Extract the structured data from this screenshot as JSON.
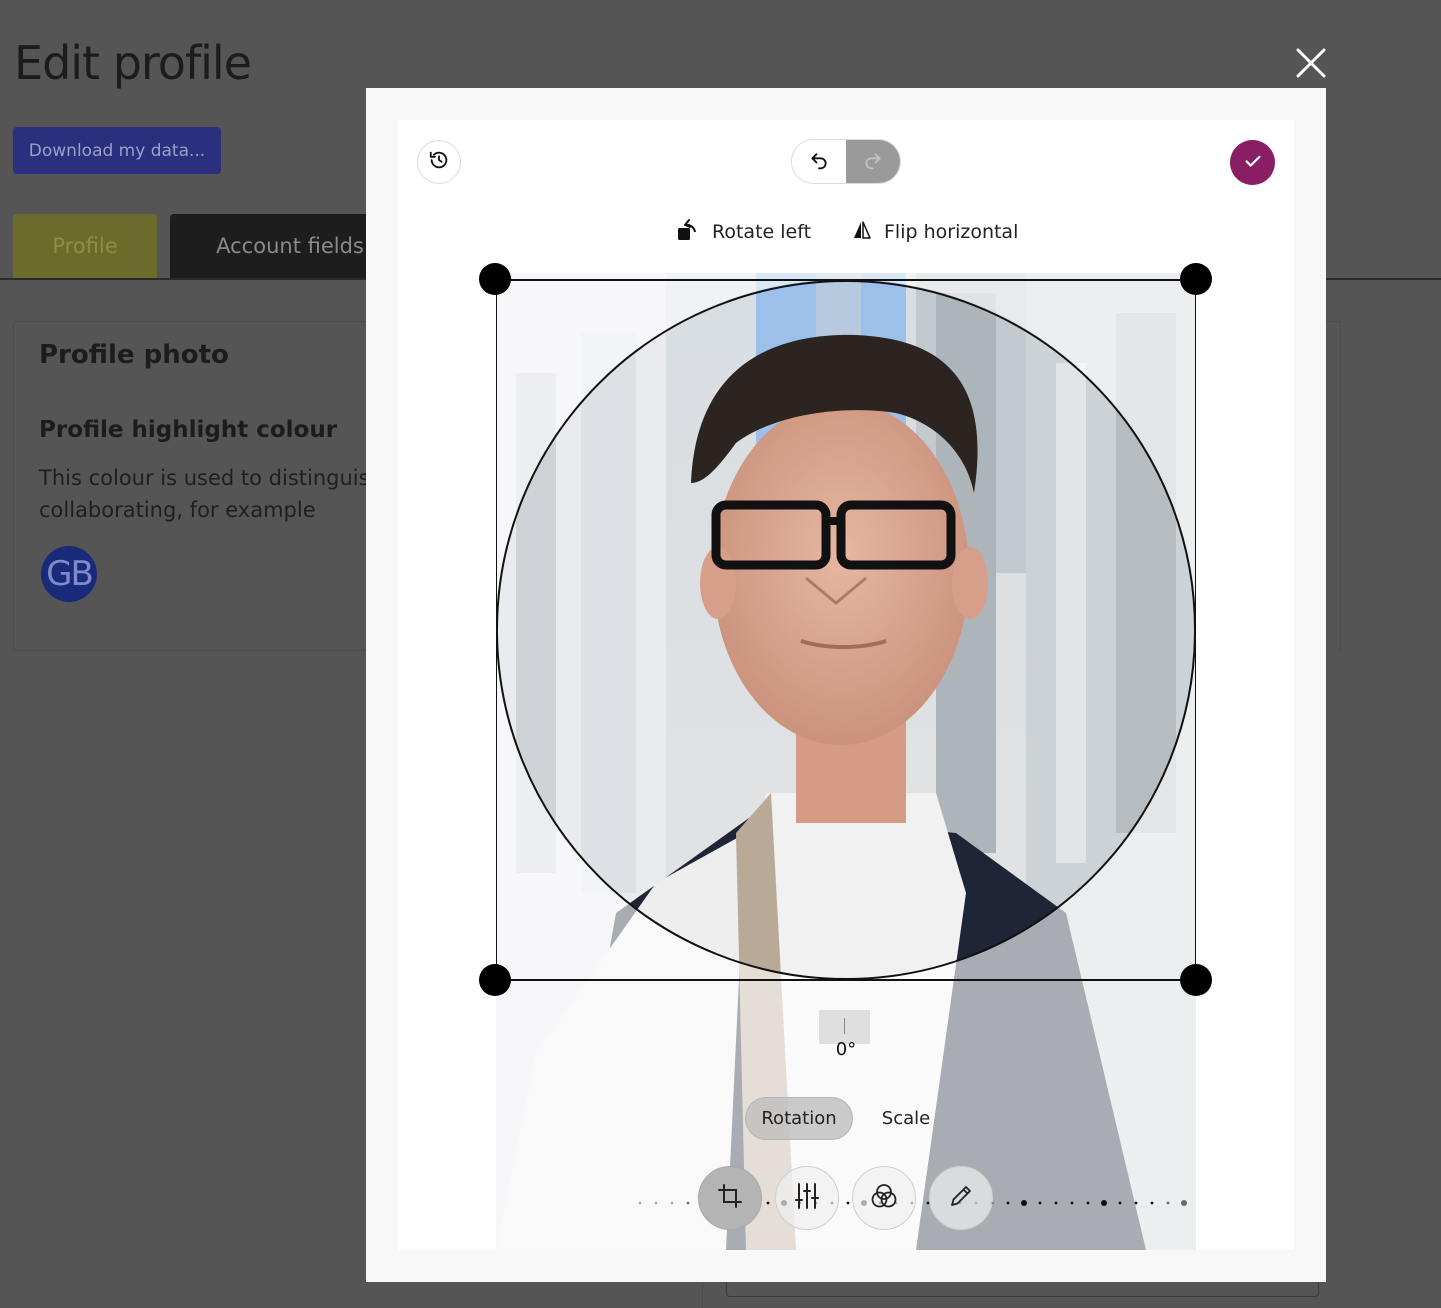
{
  "page": {
    "title": "Edit profile",
    "download_label": "Download my data...",
    "tabs": [
      {
        "label": "Profile"
      },
      {
        "label": "Account fields"
      }
    ],
    "card": {
      "title": "Profile photo",
      "highlight_title": "Profile highlight colour",
      "highlight_desc_line1": "This colour is used to distinguish",
      "highlight_desc_line2": "collaborating, for example",
      "avatar_initials": "GB"
    }
  },
  "editor": {
    "tool_options": {
      "rotate_left": "Rotate left",
      "flip_horizontal": "Flip horizontal"
    },
    "rotation_value": "0°",
    "segments": {
      "rotation": "Rotation",
      "scale": "Scale"
    },
    "toolbar_icons": [
      "crop-icon",
      "adjust-icon",
      "filter-icon",
      "annotate-icon"
    ],
    "accent_color": "#8a1e64"
  }
}
